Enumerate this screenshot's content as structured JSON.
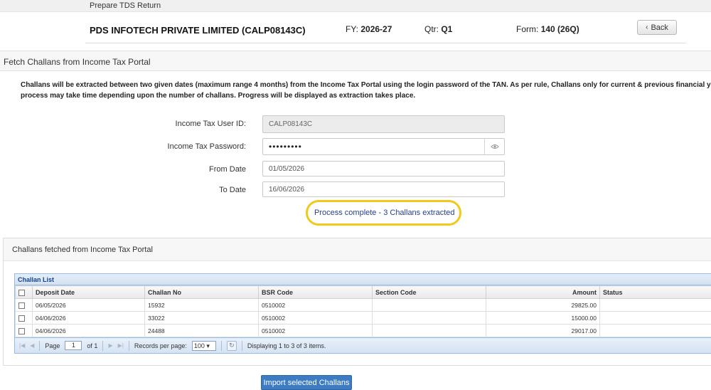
{
  "window": {
    "title": "Prepare TDS Return"
  },
  "header": {
    "company": "PDS INFOTECH PRIVATE LIMITED (CALP08143C)",
    "fy_label": "FY:",
    "fy_value": "2026-27",
    "qtr_label": "Qtr:",
    "qtr_value": "Q1",
    "form_label": "Form:",
    "form_value": "140 (26Q)",
    "back_label": "Back"
  },
  "fetch": {
    "section_title": "Fetch Challans from Income Tax Portal",
    "info_line1": "Challans will be extracted between two given dates (maximum range 4 months) from the Income Tax Portal using the login password of the TAN. As per rule, Challans only for current & previous financial years can be u",
    "info_line2": "process may take time depending upon the number of challans. Progress will be displayed as extraction takes place.",
    "user_id_label": "Income Tax User ID:",
    "user_id_value": "CALP08143C",
    "password_label": "Income Tax Password:",
    "password_mask": "•••••••••",
    "from_label": "From Date",
    "from_value": "01/05/2026",
    "to_label": "To Date",
    "to_value": "16/06/2026",
    "status": "Process complete - 3 Challans extracted"
  },
  "results": {
    "panel_title": "Challans fetched from Income Tax Portal",
    "grid_caption": "Challan List",
    "columns": [
      "Deposit Date",
      "Challan No",
      "BSR Code",
      "Section Code",
      "Amount",
      "Status"
    ],
    "rows": [
      {
        "date": "06/05/2026",
        "challan": "15932",
        "bsr": "0510002",
        "section": "",
        "amount": "29825.00",
        "status": ""
      },
      {
        "date": "04/06/2026",
        "challan": "33022",
        "bsr": "0510002",
        "section": "",
        "amount": "15000.00",
        "status": ""
      },
      {
        "date": "04/06/2026",
        "challan": "24488",
        "bsr": "0510002",
        "section": "",
        "amount": "29017.00",
        "status": ""
      }
    ],
    "pager": {
      "page_label": "Page",
      "page_value": "1",
      "of_label": "of 1",
      "per_page_label": "Records per page:",
      "per_page_value": "100",
      "display_text": "Displaying 1 to 3 of 3 items."
    }
  },
  "import_button": "Import selected Challans",
  "colors": {
    "accent": "#3d7cc4",
    "highlight_ring": "#f2c81a",
    "status_text": "#2a3c8c",
    "grid_border": "#99bbe8"
  }
}
